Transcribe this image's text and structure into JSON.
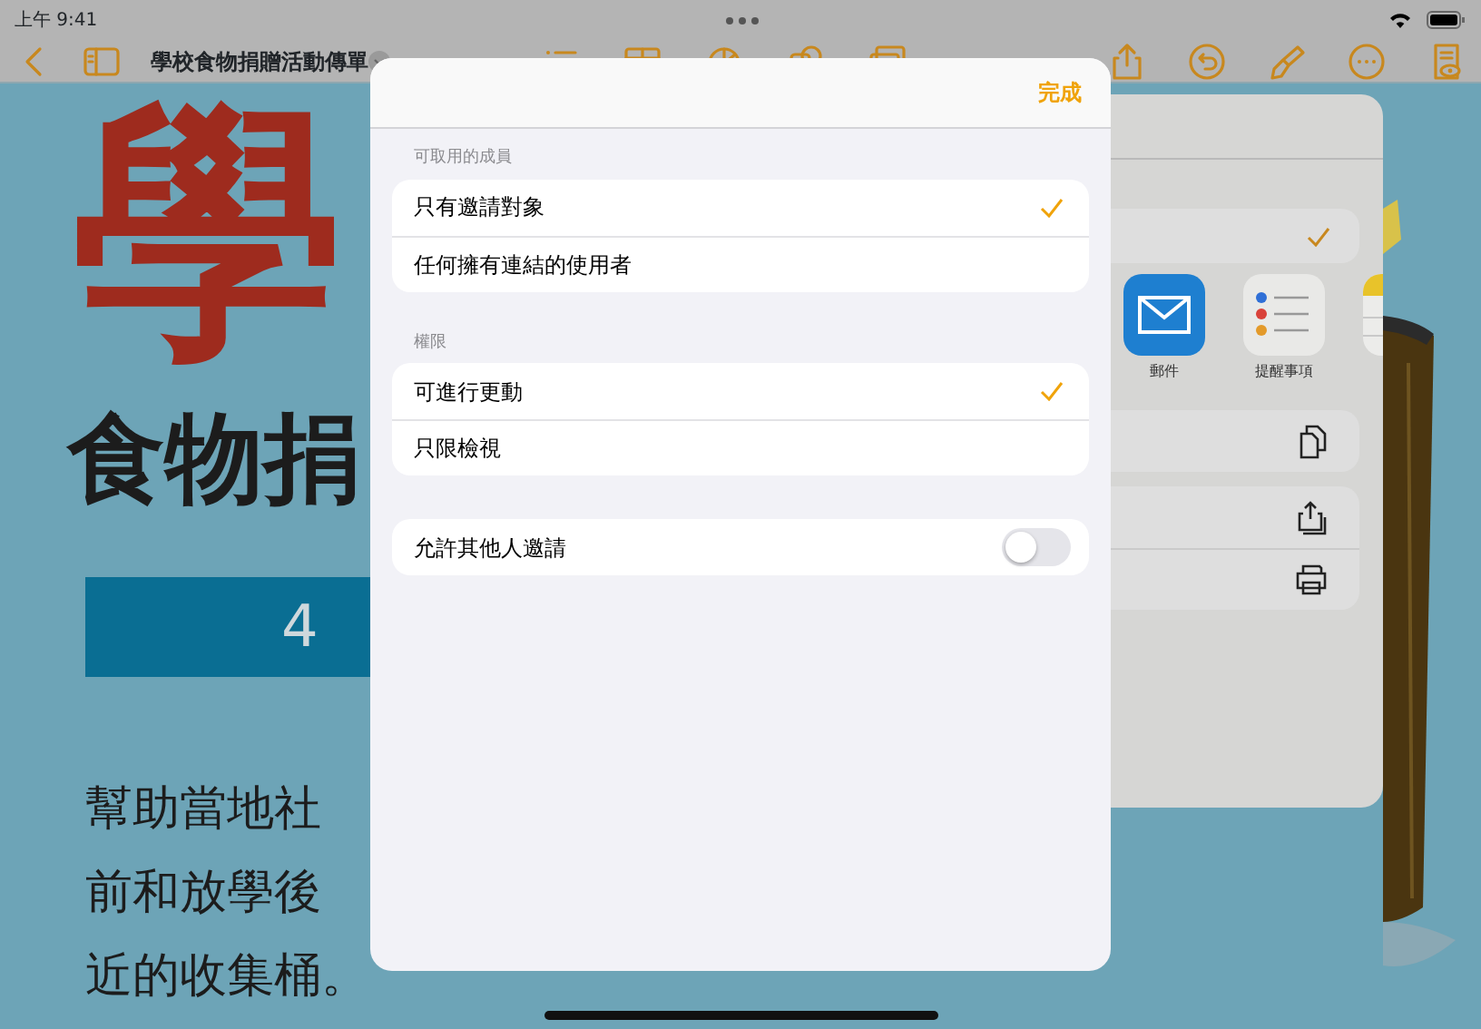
{
  "status_bar": {
    "time": "上午 9:41"
  },
  "toolbar": {
    "title": "學校食物捐贈活動傳單"
  },
  "document": {
    "title": "學",
    "subtitle": "食物捐",
    "date_banner": "4",
    "body_lines": [
      "幫助當地社",
      "前和放學後",
      "近的收集桶。"
    ]
  },
  "share_sheet": {
    "rows": [
      {
        "kind": "option",
        "checked": true
      }
    ],
    "apps": [
      {
        "kind": "mail",
        "label": "郵件"
      },
      {
        "kind": "reminders",
        "label": "提醒事項"
      },
      {
        "kind": "notes"
      }
    ],
    "actions": [
      {
        "kind": "copy"
      },
      {
        "kind": "share"
      },
      {
        "kind": "print"
      }
    ]
  },
  "share_options": {
    "done": "完成",
    "sections": [
      {
        "header": "可取用的成員",
        "options": [
          {
            "label": "只有邀請對象",
            "selected": true
          },
          {
            "label": "任何擁有連結的使用者",
            "selected": false
          }
        ]
      },
      {
        "header": "權限",
        "options": [
          {
            "label": "可進行更動",
            "selected": true
          },
          {
            "label": "只限檢視",
            "selected": false
          }
        ]
      }
    ],
    "allow_invite": {
      "label": "允許其他人邀請",
      "on": false
    }
  }
}
